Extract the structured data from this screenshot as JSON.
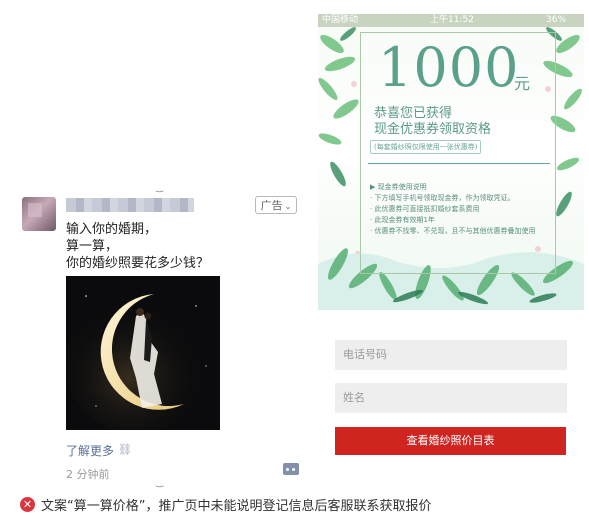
{
  "post": {
    "ad_label": "广告",
    "text_lines": [
      "输入你的婚期，",
      "算一算，",
      "你的婚纱照要花多少钱？"
    ],
    "learn_more": "了解更多",
    "time": "2 分钟前"
  },
  "landing": {
    "status_bar": {
      "carrier": "中国移动",
      "time": "上午11:52",
      "battery": "36%"
    },
    "amount": "1000",
    "unit": "元",
    "congrats_line1": "恭喜您已获得",
    "congrats_line2": "现金优惠券领取资格",
    "note": "(每套婚纱照仅限使用一张优惠券)",
    "rules_title": "▶ 现金券使用说明",
    "rules": [
      "· 下方填写手机号领取现金券，作为领取凭证。",
      "· 此优惠券可直接抵扣婚纱套系费用",
      "· 此现金券有效期1年",
      "· 优惠券不找零、不兑现，且不与其他优惠券叠加使用"
    ],
    "phone_placeholder": "电话号码",
    "name_placeholder": "姓名",
    "submit_label": "查看婚纱照价目表"
  },
  "verdict": {
    "text": "文案“算一算价格”，推广页中未能说明登记信息后客服联系获取报价",
    "icon": "error-icon",
    "color": "#d9363e"
  }
}
